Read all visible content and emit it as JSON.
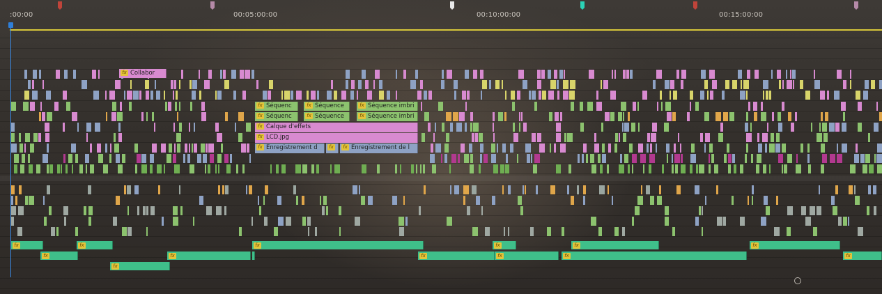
{
  "ruler": {
    "timecodes": [
      ":00:00",
      "00:05:00:00",
      "00:10:00:00",
      "00:15:00:00"
    ],
    "markers": [
      {
        "color": "#c0443a"
      },
      {
        "color": "#b58aa8"
      },
      {
        "color": "#e8e8e8"
      },
      {
        "color": "#2bd2b6"
      },
      {
        "color": "#c0443a"
      },
      {
        "color": "#b58aa8"
      }
    ]
  },
  "colors": {
    "work_area": "#d7c73a",
    "playhead": "#3b8be6",
    "clip_pink": "#d88ad0",
    "clip_green": "#8cc26e",
    "clip_blue": "#8ea2c4",
    "clip_seafoam": "#3fbf8a",
    "fx_badge": "#e3c33a"
  },
  "fx_badge_text": "fx",
  "clips": [
    {
      "label": "Collabor",
      "color": "pink",
      "track": "V13",
      "fx": true
    },
    {
      "label": "Séquenc",
      "color": "green",
      "track": "V9",
      "fx": true
    },
    {
      "label": "Séquence",
      "color": "green",
      "track": "V9",
      "fx": true
    },
    {
      "label": "Séquence imbri",
      "color": "green",
      "track": "V9",
      "fx": true
    },
    {
      "label": "Séquenc",
      "color": "green",
      "track": "V8",
      "fx": true
    },
    {
      "label": "Séquence",
      "color": "green",
      "track": "V8",
      "fx": true
    },
    {
      "label": "Séquence imbri",
      "color": "green",
      "track": "V8",
      "fx": true
    },
    {
      "label": "Calque d'effets",
      "color": "pink",
      "track": "V7",
      "fx": true
    },
    {
      "label": "LCD.jpg",
      "color": "pink",
      "track": "V6",
      "fx": true
    },
    {
      "label": "Enregistrement d",
      "color": "blue",
      "track": "V5",
      "fx": true
    },
    {
      "label": "Enregistrement de l",
      "color": "blue",
      "track": "V5",
      "fx": true
    }
  ],
  "audio_clips_fx_count": 14
}
